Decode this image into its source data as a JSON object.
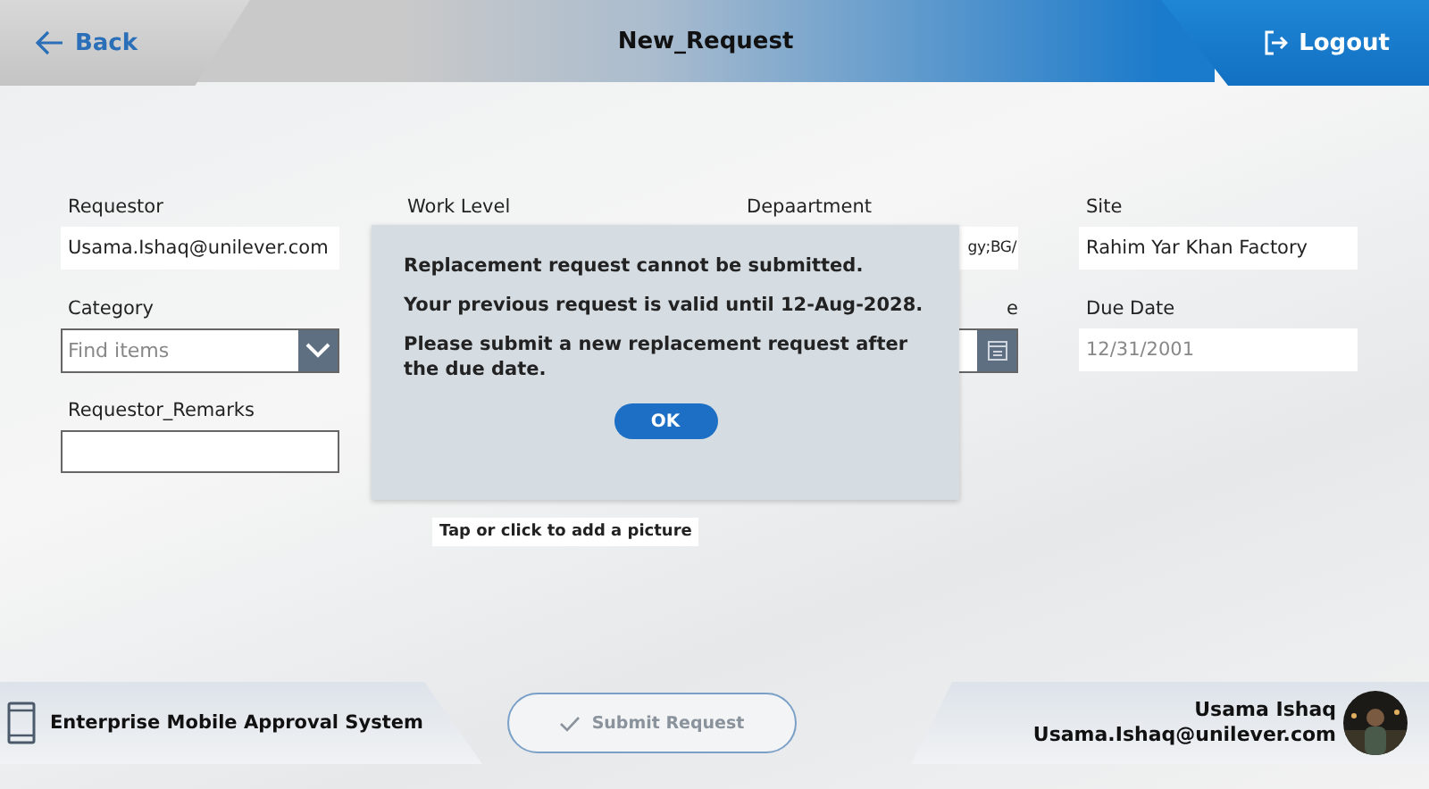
{
  "header": {
    "back": "Back",
    "title": "New_Request",
    "logout": "Logout"
  },
  "fields": [
    {
      "kind": "text",
      "label": "Requestor",
      "value": "Usama.Ishaq@unilever.com"
    },
    {
      "kind": "hidden",
      "label": "Work Level"
    },
    {
      "kind": "partial_text",
      "label": "Depaartment",
      "value": "gy;BG/"
    },
    {
      "kind": "text",
      "label": "Site",
      "value": "Rahim Yar Khan Factory"
    },
    {
      "kind": "dropdown",
      "label": "Category",
      "placeholder": "Find items"
    },
    {
      "kind": "none"
    },
    {
      "kind": "date",
      "label": "e"
    },
    {
      "kind": "text",
      "label": "Due Date",
      "placeholder": "12/31/2001"
    },
    {
      "kind": "text",
      "label": "Requestor_Remarks"
    }
  ],
  "picture_hint": "Tap or click to add a picture",
  "dialog": {
    "lines": [
      "Replacement request cannot be submitted.",
      "Your previous request is valid until 12-Aug-2028.",
      "Please submit a new replacement request after the due date."
    ],
    "button": "OK"
  },
  "footer": {
    "app_name": "Enterprise Mobile Approval System",
    "submit": {
      "label": "Submit Request",
      "disabled": true
    },
    "user_name": "Usama Ishaq",
    "user_email": "Usama.Ishaq@unilever.com"
  }
}
